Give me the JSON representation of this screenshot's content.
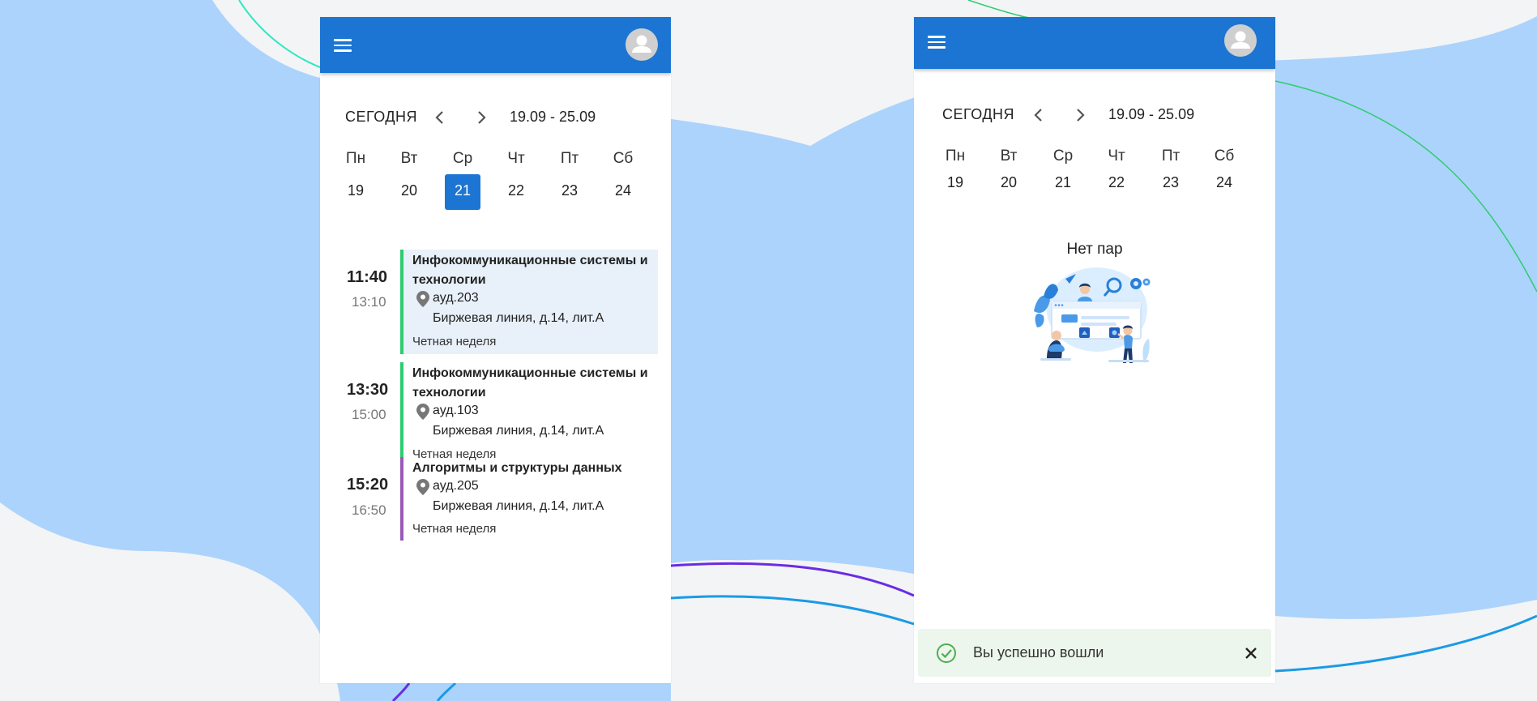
{
  "colors": {
    "accent": "#1c75d3",
    "background_shape": "#acd3fb",
    "event_green": "#2ecc71",
    "event_purple": "#9b59b6",
    "active_card": "#e8f0fa",
    "toast_bg": "#edf6ec"
  },
  "left_screen": {
    "appbar": {
      "menu_icon": "hamburger-menu-icon",
      "avatar_icon": "account-avatar-icon"
    },
    "weekbar": {
      "today_label": "СЕГОДНЯ",
      "range": "19.09 - 25.09"
    },
    "days": [
      {
        "name": "Пн",
        "num": "19"
      },
      {
        "name": "Вт",
        "num": "20"
      },
      {
        "name": "Ср",
        "num": "21"
      },
      {
        "name": "Чт",
        "num": "22"
      },
      {
        "name": "Пт",
        "num": "23"
      },
      {
        "name": "Сб",
        "num": "24"
      }
    ],
    "selected_day": "21",
    "lessons": [
      {
        "start": "11:40",
        "end": "13:10",
        "title": "Инфокоммуникационные системы и технологии",
        "room": "ауд.203",
        "address": "Биржевая линия, д.14, лит.А",
        "week": "Четная неделя",
        "color": "#2ecc71"
      },
      {
        "start": "13:30",
        "end": "15:00",
        "title": "Инфокоммуникационные системы и технологии",
        "room": "ауд.103",
        "address": "Биржевая линия, д.14, лит.А",
        "week": "Четная неделя",
        "color": "#2ecc71"
      },
      {
        "start": "15:20",
        "end": "16:50",
        "title": "Алгоритмы и структуры данных",
        "room": "ауд.205",
        "address": "Биржевая линия, д.14, лит.А",
        "week": "Четная неделя",
        "color": "#9b59b6"
      }
    ]
  },
  "right_screen": {
    "appbar": {
      "menu_icon": "hamburger-menu-icon",
      "avatar_icon": "account-avatar-icon"
    },
    "weekbar": {
      "today_label": "СЕГОДНЯ",
      "range": "19.09 - 25.09"
    },
    "days": [
      {
        "name": "Пн",
        "num": "19"
      },
      {
        "name": "Вт",
        "num": "20"
      },
      {
        "name": "Ср",
        "num": "21"
      },
      {
        "name": "Чт",
        "num": "22"
      },
      {
        "name": "Пт",
        "num": "23"
      },
      {
        "name": "Сб",
        "num": "24"
      }
    ],
    "empty_message": "Нет пар",
    "toast": {
      "message": "Вы успешно вошли",
      "icon": "check-circle-icon",
      "close_icon": "close-icon"
    }
  }
}
